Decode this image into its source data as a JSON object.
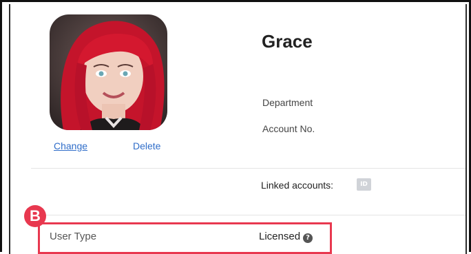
{
  "profile": {
    "name": "Grace",
    "change_label": "Change",
    "delete_label": "Delete"
  },
  "fields": {
    "department_label": "Department",
    "account_no_label": "Account No.",
    "linked_accounts_label": "Linked accounts:",
    "linked_account_icon": "id-card-icon"
  },
  "user_type": {
    "label": "User Type",
    "value": "Licensed",
    "help_icon": "question-circle-icon"
  },
  "annotation": {
    "badge_letter": "B",
    "accent_color": "#e8384f"
  },
  "colors": {
    "link": "#2f6dc9",
    "text": "#222222"
  }
}
